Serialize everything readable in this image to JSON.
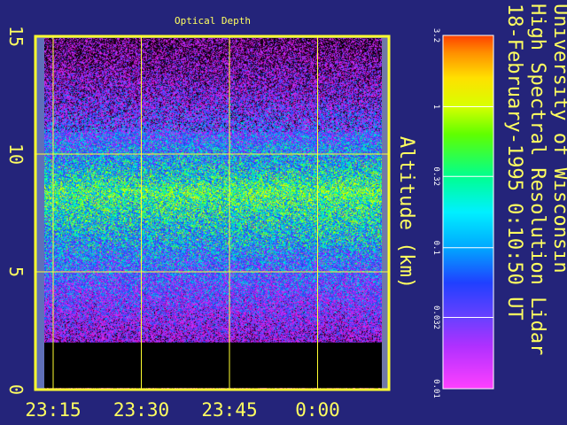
{
  "chart_data": {
    "type": "heatmap",
    "title": "Optical Depth",
    "ylabel": "Altitude (km)",
    "xlabel": "",
    "x_ticks": [
      "23:15",
      "23:30",
      "23:45",
      "0:00"
    ],
    "y_ticks": [
      0,
      5,
      10,
      15
    ],
    "ylim": [
      0,
      15
    ],
    "grid": true,
    "ground_top_km": 2.0,
    "layer_peak_km": 8.5,
    "colorbar": {
      "scale": "log",
      "ticks": [
        "3.2",
        "1",
        "0.32",
        "0.1",
        "0.032",
        "0.01"
      ],
      "range": [
        0.01,
        3.2
      ]
    },
    "side_text": [
      "University of Wisconsin",
      "High Spectral Resolution Lidar",
      "18-February-1995   0:10:50 UT"
    ]
  },
  "colors": {
    "background": "#24247a",
    "frame": "#ffff30",
    "text": "#ffff60",
    "ground": "#000000"
  }
}
